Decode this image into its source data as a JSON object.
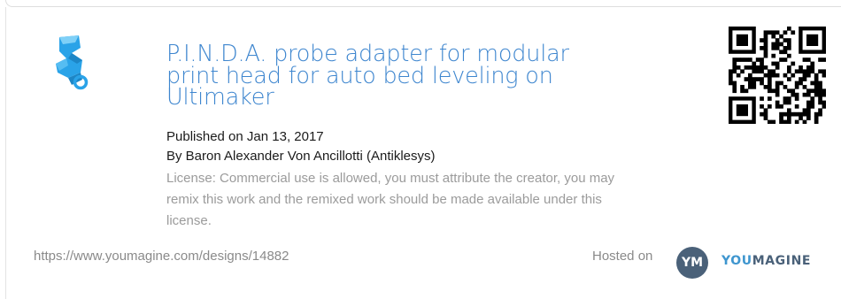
{
  "design": {
    "title": "P.I.N.D.A. probe adapter for modular print head for auto bed leveling on Ultimaker",
    "published": "Published on Jan 13, 2017",
    "author": "By Baron Alexander Von Ancillotti (Antiklesys)",
    "license": "License: Commercial use is allowed, you must attribute the creator, you may remix this work and the remixed work should be made available under this license.",
    "thumbnail_icon": "probe-adapter-model-icon",
    "qr_icon": "qr-code-icon"
  },
  "footer": {
    "url": "https://www.youmagine.com/designs/14882",
    "hosted_label": "Hosted on",
    "logo_badge": "YM",
    "logo_you": "YOU",
    "logo_magine": "MAGINE"
  },
  "colors": {
    "title": "#3e86cf",
    "license": "#9b9b9b",
    "logo_dark": "#4a6179",
    "logo_accent": "#3f96cf",
    "thumbnail": "#2aa3e8"
  }
}
